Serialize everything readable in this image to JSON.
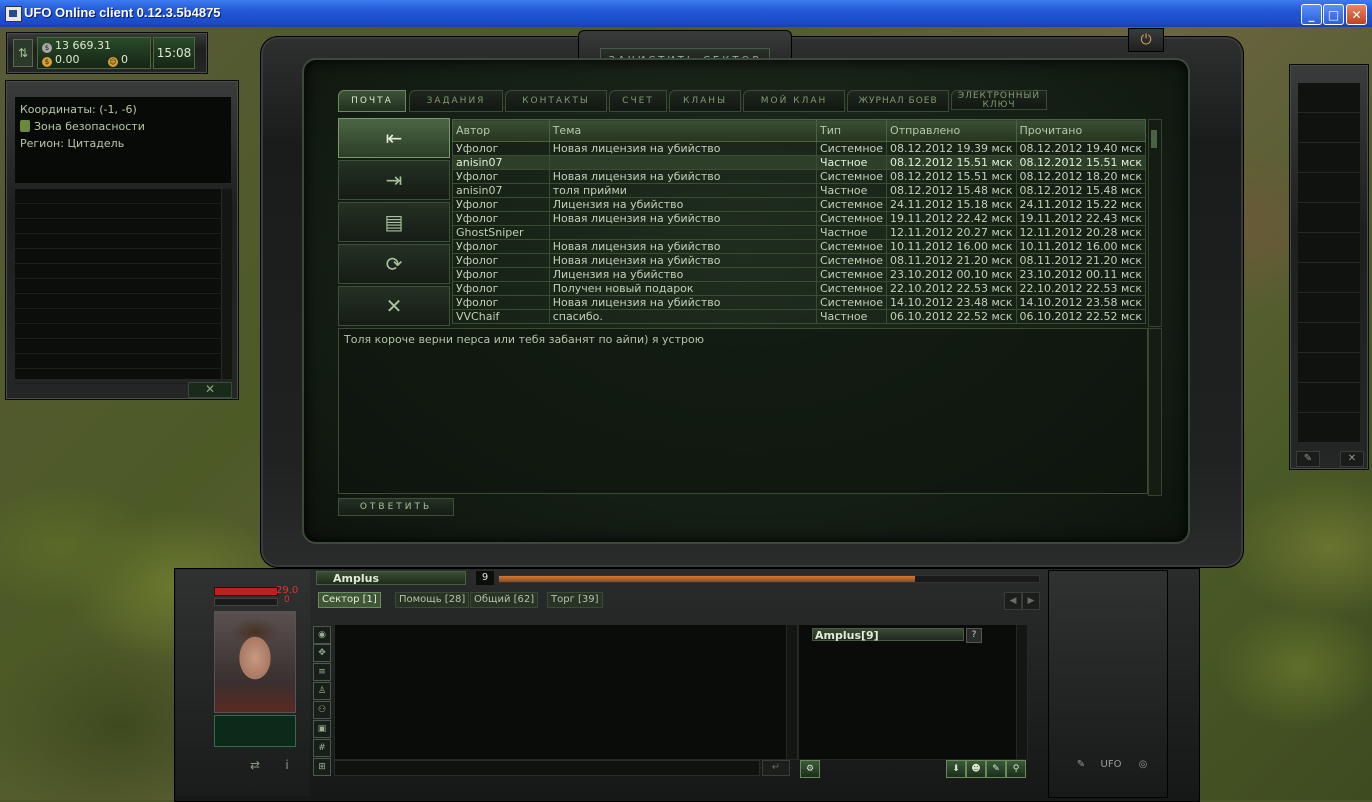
{
  "window": {
    "title": "UFO Online client 0.12.3.5b4875",
    "minimize": "_",
    "maximize": "□",
    "close": "✕"
  },
  "status": {
    "money_silver": "13 669.31",
    "money_gold": "0.00",
    "currency_other": "0",
    "time": "15:08"
  },
  "location": {
    "coords": "Координаты: (-1, -6)",
    "zone": "Зона безопасности",
    "region": "Регион: Цитадель",
    "close_label": "✕"
  },
  "main": {
    "clear_sector": "ЗАЧИСТИТЬ СЕКТОР",
    "power_icon": "⏻",
    "tabs": [
      {
        "label": "ПОЧТА"
      },
      {
        "label": "ЗАДАНИЯ"
      },
      {
        "label": "КОНТАКТЫ"
      },
      {
        "label": "СЧЕТ"
      },
      {
        "label": "КЛАНЫ"
      },
      {
        "label": "МОЙ КЛАН"
      },
      {
        "label": "ЖУРНАЛ БОЕВ"
      },
      {
        "label": "ЭЛЕКТРОННЫЙ КЛЮЧ"
      }
    ],
    "actions": [
      {
        "name": "inbox-icon",
        "glyph": "⇤"
      },
      {
        "name": "outbox-icon",
        "glyph": "⇥"
      },
      {
        "name": "new-message-icon",
        "glyph": "▤"
      },
      {
        "name": "refresh-icon",
        "glyph": "⟳"
      },
      {
        "name": "delete-icon",
        "glyph": "✕"
      }
    ],
    "columns": [
      "Автор",
      "Тема",
      "Тип",
      "Отправлено",
      "Прочитано"
    ],
    "rows": [
      [
        "Уфолог",
        "Новая лицензия на убийство",
        "Системное",
        "08.12.2012 19.39 мск",
        "08.12.2012 19.40 мск"
      ],
      [
        "anisin07",
        "",
        "Частное",
        "08.12.2012 15.51 мск",
        "08.12.2012 15.51 мск"
      ],
      [
        "Уфолог",
        "Новая лицензия на убийство",
        "Системное",
        "08.12.2012 15.51 мск",
        "08.12.2012 18.20 мск"
      ],
      [
        "anisin07",
        "толя прийми",
        "Частное",
        "08.12.2012 15.48 мск",
        "08.12.2012 15.48 мск"
      ],
      [
        "Уфолог",
        "Лицензия на убийство",
        "Системное",
        "24.11.2012 15.18 мск",
        "24.11.2012 15.22 мск"
      ],
      [
        "Уфолог",
        "Новая лицензия на убийство",
        "Системное",
        "19.11.2012 22.42 мск",
        "19.11.2012 22.43 мск"
      ],
      [
        "GhostSniper",
        "",
        "Частное",
        "12.11.2012 20.27 мск",
        "12.11.2012 20.28 мск"
      ],
      [
        "Уфолог",
        "Новая лицензия на убийство",
        "Системное",
        "10.11.2012 16.00 мск",
        "10.11.2012 16.00 мск"
      ],
      [
        "Уфолог",
        "Новая лицензия на убийство",
        "Системное",
        "08.11.2012 21.20 мск",
        "08.11.2012 21.20 мск"
      ],
      [
        "Уфолог",
        "Лицензия на убийство",
        "Системное",
        "23.10.2012 00.10 мск",
        "23.10.2012 00.11 мск"
      ],
      [
        "Уфолог",
        "Получен новый подарок",
        "Системное",
        "22.10.2012 22.53 мск",
        "22.10.2012 22.53 мск"
      ],
      [
        "Уфолог",
        "Новая лицензия на убийство",
        "Системное",
        "14.10.2012 23.48 мск",
        "14.10.2012 23.58 мск"
      ],
      [
        "VVChaif",
        "спасибо.",
        "Частное",
        "06.10.2012 22.52 мск",
        "06.10.2012 22.52 мск"
      ]
    ],
    "selected_row": 1,
    "message_body": "Толя короче верни перса или тебя забанят по айпи) я устрою",
    "reply": "ОТВЕТИТЬ"
  },
  "player": {
    "name": "Amplus",
    "level": "9",
    "hp": "29.0",
    "stamina": "0",
    "xp_progress": 0.77
  },
  "chat": {
    "tabs": [
      "Сектор [1]",
      "Помощь [28]",
      "Общий [62]",
      "Торг [39]"
    ],
    "active_tab": 0,
    "users": [
      {
        "name": "Amplus[9]",
        "flag": "?"
      }
    ]
  },
  "bottom_right": {
    "ufo_label": "UFO"
  }
}
